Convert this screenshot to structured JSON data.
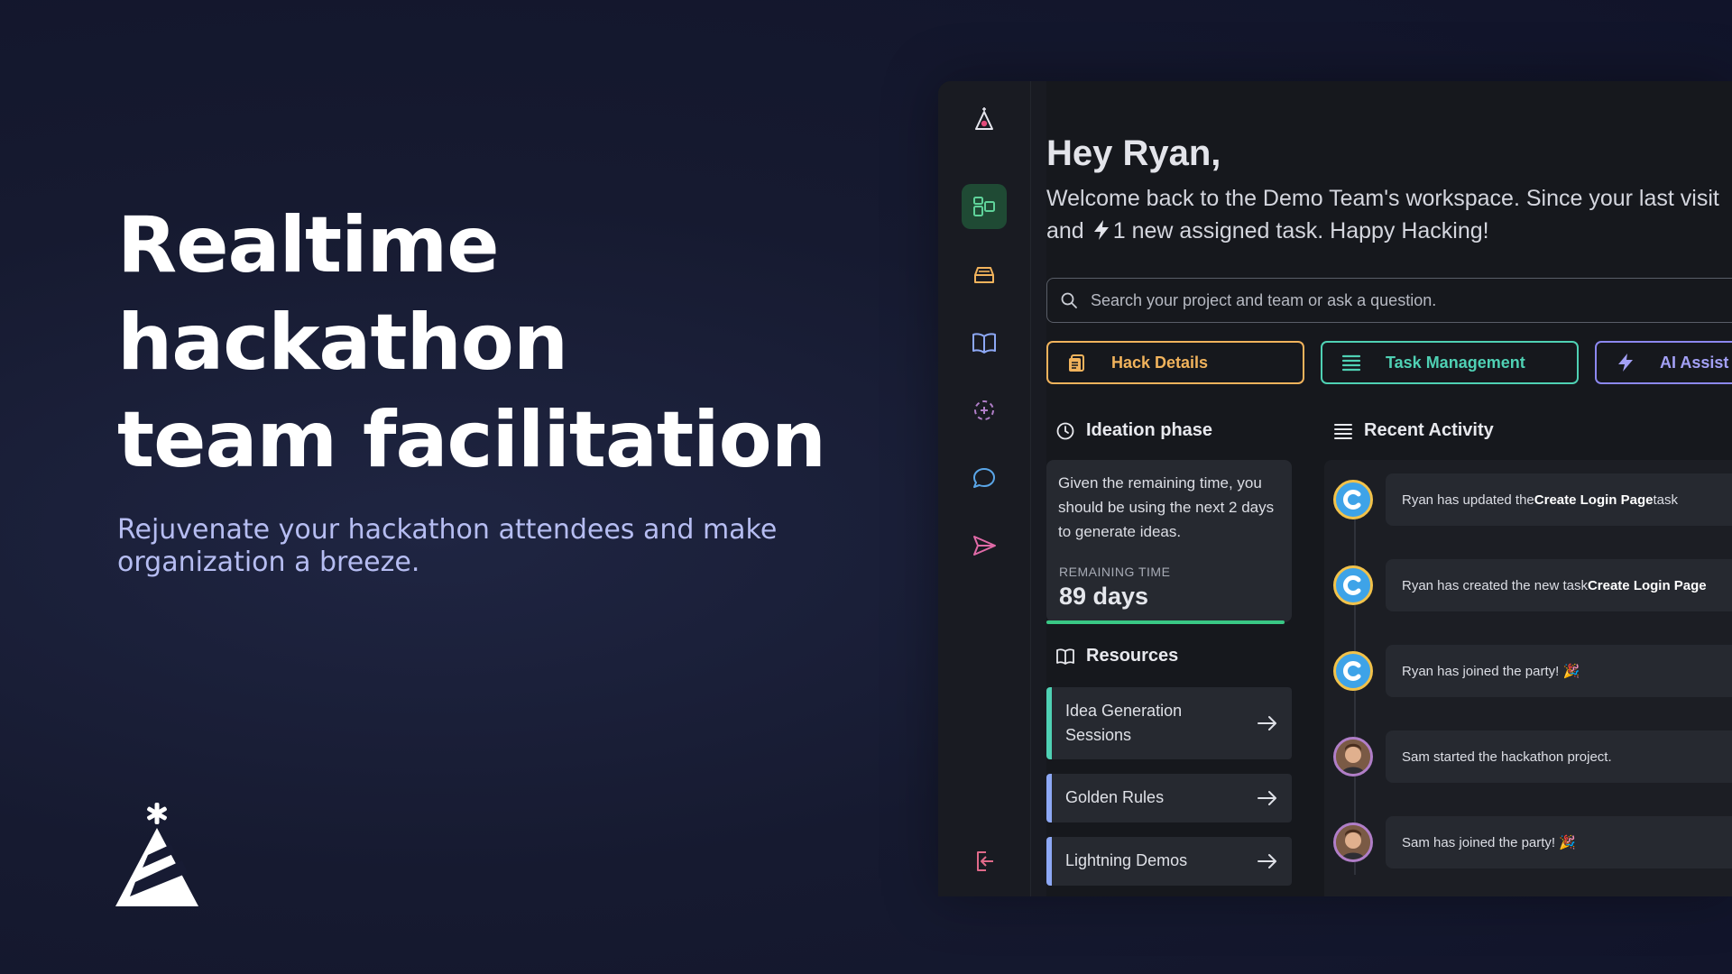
{
  "hero": {
    "headline_line1": "Realtime hackathon",
    "headline_line2": "team facilitation",
    "subheadline": "Rejuvenate your hackathon attendees and make organization a breeze."
  },
  "app": {
    "rail": {
      "items": [
        {
          "icon": "party-hat-icon"
        },
        {
          "icon": "dashboard-icon",
          "active": true
        },
        {
          "icon": "inbox-icon"
        },
        {
          "icon": "book-icon"
        },
        {
          "icon": "focus-icon"
        },
        {
          "icon": "chat-icon"
        },
        {
          "icon": "send-icon"
        },
        {
          "icon": "logout-icon"
        }
      ]
    },
    "greeting": {
      "title": "Hey Ryan,",
      "line1": "Welcome back to the Demo Team's workspace. Since your last visit",
      "line2_prefix": "and",
      "line2_suffix": "1 new assigned task. Happy Hacking!"
    },
    "search": {
      "placeholder": "Search your project and team or ask a question."
    },
    "quick_actions": {
      "hack_details": "Hack Details",
      "task_management": "Task Management",
      "ai_assist": "AI Assist"
    },
    "ideation": {
      "title": "Ideation phase",
      "description": "Given the remaining time, you should be using the next 2 days to generate ideas.",
      "remaining_label": "REMAINING TIME",
      "remaining_value": "89 days",
      "progress": 1.0
    },
    "resources": {
      "title": "Resources",
      "items": [
        {
          "label": "Idea Generation Sessions",
          "color": "#4fd1b4"
        },
        {
          "label": "Golden Rules",
          "color": "#8da8f5"
        },
        {
          "label": "Lightning Demos",
          "color": "#8da8f5"
        }
      ]
    },
    "activity": {
      "title": "Recent Activity",
      "items": [
        {
          "avatar": "c",
          "pre": "Ryan has updated the ",
          "bold": "Create Login Page",
          "post": " task"
        },
        {
          "avatar": "c",
          "pre": "Ryan has created the new task ",
          "bold": "Create Login Page",
          "post": ""
        },
        {
          "avatar": "c",
          "pre": "Ryan has joined the party! 🎉",
          "bold": "",
          "post": ""
        },
        {
          "avatar": "face",
          "pre": "Sam started the hackathon project.",
          "bold": "",
          "post": ""
        },
        {
          "avatar": "face",
          "pre": "Sam has joined the party! 🎉",
          "bold": "",
          "post": ""
        }
      ]
    },
    "colors": {
      "accent_orange": "#f1b35c",
      "accent_teal": "#4fd1b4",
      "accent_purple": "#8c88f0",
      "progress_green": "#39c784"
    }
  }
}
